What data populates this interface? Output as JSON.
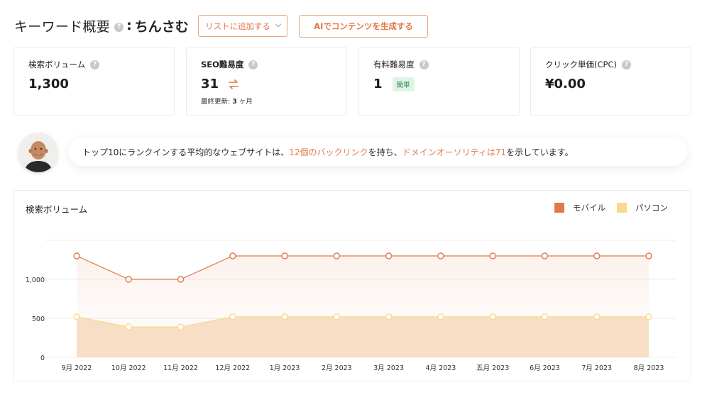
{
  "header": {
    "title": "キーワード概要",
    "help_icon": "question-circle-icon",
    "separator": ":",
    "keyword": "ちんさむ",
    "list_button_label": "リストに追加する",
    "ai_button_label": "AIでコンテンツを生成する"
  },
  "metrics": [
    {
      "label": "検索ボリューム",
      "value": "1,300"
    },
    {
      "label": "SEO難易度",
      "value": "31",
      "sub_prefix": "最終更新:",
      "sub_value": "3",
      "sub_suffix": "ヶ月"
    },
    {
      "label": "有料難易度",
      "value": "1",
      "badge": "簡単"
    },
    {
      "label": "クリック単価(CPC)",
      "value": "¥0.00"
    }
  ],
  "insight": {
    "part1": "トップ10にランクインする平均的なウェブサイトは、",
    "highlight1": "12個のバックリンク",
    "part2": "を持ち、",
    "highlight2": "ドメインオーソリティは71",
    "part3": "を示しています。"
  },
  "chart": {
    "title": "検索ボリューム",
    "legend": [
      {
        "label": "モバイル",
        "color": "#e07a49"
      },
      {
        "label": "パソコン",
        "color": "#f8da8c"
      }
    ]
  },
  "colors": {
    "accent": "#e07a49",
    "desktop": "#f8da8c",
    "easy_badge_bg": "#dff3e6",
    "easy_badge_text": "#2f8a4f"
  },
  "chart_data": {
    "type": "area",
    "title": "検索ボリューム",
    "categories": [
      "9月 2022",
      "10月 2022",
      "11月 2022",
      "12月 2022",
      "1月 2023",
      "2月 2023",
      "3月 2023",
      "4月 2023",
      "五月 2023",
      "6月 2023",
      "7月 2023",
      "8月 2023"
    ],
    "series": [
      {
        "name": "モバイル",
        "values": [
          1300,
          1000,
          1000,
          1300,
          1300,
          1300,
          1300,
          1300,
          1300,
          1300,
          1300,
          1300
        ]
      },
      {
        "name": "パソコン",
        "values": [
          520,
          390,
          390,
          520,
          520,
          520,
          520,
          520,
          520,
          520,
          520,
          520
        ]
      }
    ],
    "yticks": [
      0,
      500,
      1000
    ],
    "ytick_labels": [
      "0",
      "500",
      "1,000"
    ],
    "ylim": [
      0,
      1500
    ],
    "grid": true,
    "legend_position": "top-right"
  }
}
